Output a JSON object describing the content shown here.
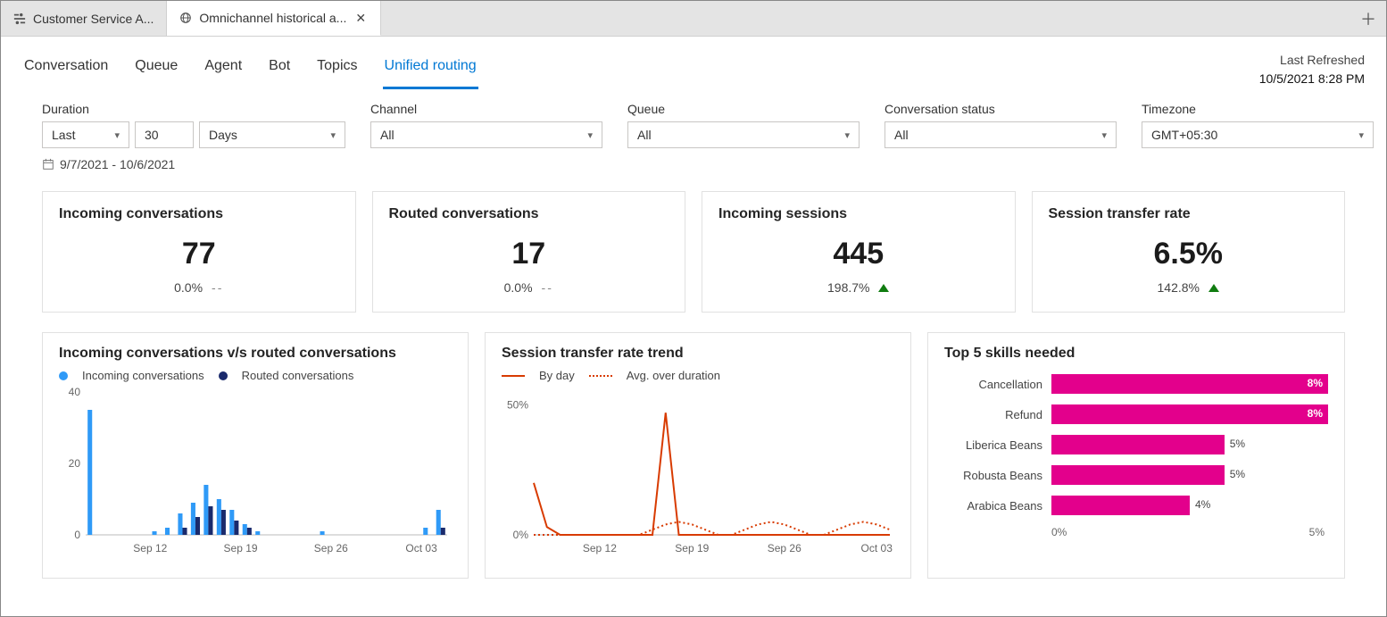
{
  "tabstrip": {
    "tabs": [
      {
        "label": "Customer Service A...",
        "icon": "settings"
      },
      {
        "label": "Omnichannel historical a...",
        "icon": "globe",
        "active": true,
        "closeable": true
      }
    ]
  },
  "nav": {
    "items": [
      "Conversation",
      "Queue",
      "Agent",
      "Bot",
      "Topics",
      "Unified routing"
    ],
    "active": "Unified routing",
    "refreshed_label": "Last Refreshed",
    "refreshed_ts": "10/5/2021 8:28 PM"
  },
  "filters": {
    "duration": {
      "label": "Duration",
      "mode": "Last",
      "count": "30",
      "unit": "Days",
      "range": "9/7/2021 - 10/6/2021"
    },
    "channel": {
      "label": "Channel",
      "value": "All"
    },
    "queue": {
      "label": "Queue",
      "value": "All"
    },
    "status": {
      "label": "Conversation status",
      "value": "All"
    },
    "timezone": {
      "label": "Timezone",
      "value": "GMT+05:30"
    }
  },
  "kpi": [
    {
      "title": "Incoming conversations",
      "value": "77",
      "delta": "0.0%",
      "trend": "flat"
    },
    {
      "title": "Routed conversations",
      "value": "17",
      "delta": "0.0%",
      "trend": "flat"
    },
    {
      "title": "Incoming sessions",
      "value": "445",
      "delta": "198.7%",
      "trend": "up"
    },
    {
      "title": "Session transfer rate",
      "value": "6.5%",
      "delta": "142.8%",
      "trend": "up"
    }
  ],
  "charts": {
    "panel1": {
      "title": "Incoming conversations v/s routed conversations",
      "legend": [
        "Incoming conversations",
        "Routed conversations"
      ]
    },
    "panel2": {
      "title": "Session transfer rate trend",
      "legend": [
        "By day",
        "Avg. over duration"
      ]
    },
    "panel3": {
      "title": "Top 5 skills needed",
      "axis_min": "0%",
      "axis_max": "5%"
    }
  },
  "chart_data": [
    {
      "id": "panel1",
      "type": "bar",
      "title": "Incoming conversations v/s routed conversations",
      "ylabel": "",
      "xlabel": "",
      "xticks": [
        "Sep 12",
        "Sep 19",
        "Sep 26",
        "Oct 03"
      ],
      "yticks": [
        0,
        20,
        40
      ],
      "ylim": [
        0,
        40
      ],
      "series": [
        {
          "name": "Incoming conversations",
          "color": "#2f9af7",
          "values": [
            35,
            0,
            0,
            0,
            0,
            1,
            2,
            6,
            9,
            14,
            10,
            7,
            3,
            1,
            0,
            0,
            0,
            0,
            1,
            0,
            0,
            0,
            0,
            0,
            0,
            0,
            2,
            7
          ]
        },
        {
          "name": "Routed conversations",
          "color": "#1a2a6c",
          "values": [
            0,
            0,
            0,
            0,
            0,
            0,
            0,
            2,
            5,
            8,
            7,
            4,
            2,
            0,
            0,
            0,
            0,
            0,
            0,
            0,
            0,
            0,
            0,
            0,
            0,
            0,
            0,
            2
          ]
        }
      ]
    },
    {
      "id": "panel2",
      "type": "line",
      "title": "Session transfer rate trend",
      "ylabel": "",
      "xlabel": "",
      "xticks": [
        "Sep 12",
        "Sep 19",
        "Sep 26",
        "Oct 03"
      ],
      "yticks": [
        "0%",
        "50%"
      ],
      "ylim": [
        0,
        55
      ],
      "series": [
        {
          "name": "By day",
          "style": "solid",
          "color": "#d83b01",
          "values": [
            20,
            3,
            0,
            0,
            0,
            0,
            0,
            0,
            0,
            0,
            47,
            0,
            0,
            0,
            0,
            0,
            0,
            0,
            0,
            0,
            0,
            0,
            0,
            0,
            0,
            0,
            0,
            0
          ]
        },
        {
          "name": "Avg. over duration",
          "style": "dotted",
          "color": "#d83b01",
          "values": [
            0,
            0,
            0,
            0,
            0,
            0,
            0,
            0,
            0,
            2,
            4,
            5,
            4,
            2,
            0,
            0,
            2,
            4,
            5,
            4,
            2,
            0,
            0,
            2,
            4,
            5,
            4,
            2
          ]
        }
      ]
    },
    {
      "id": "panel3",
      "type": "bar",
      "orientation": "horizontal",
      "title": "Top 5 skills needed",
      "xlim": [
        0,
        8
      ],
      "xticks": [
        "0%",
        "5%"
      ],
      "categories": [
        "Cancellation",
        "Refund",
        "Liberica Beans",
        "Robusta Beans",
        "Arabica Beans"
      ],
      "values": [
        8,
        8,
        5,
        5,
        4
      ],
      "value_labels": [
        "8%",
        "8%",
        "5%",
        "5%",
        "4%"
      ],
      "color": "#e3008c"
    }
  ]
}
